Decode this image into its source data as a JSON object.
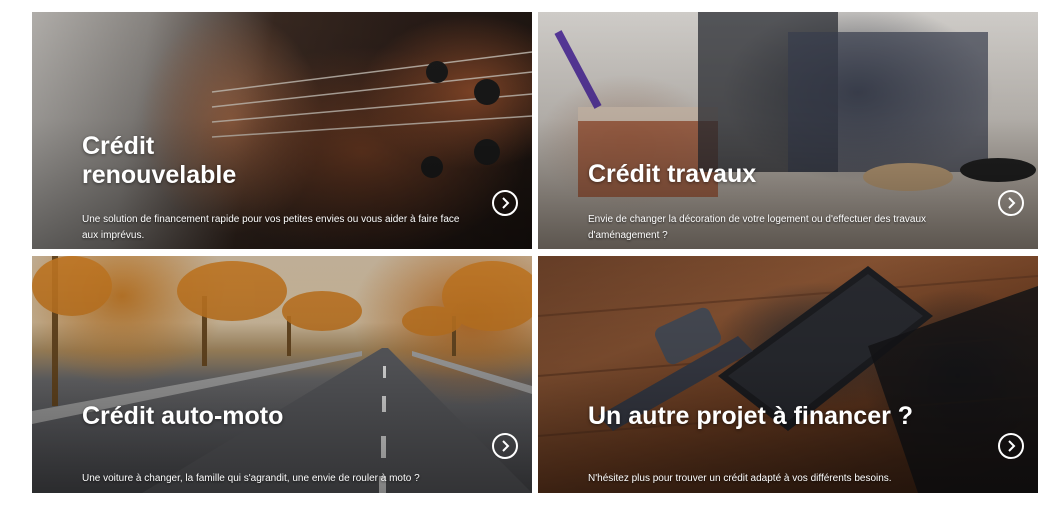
{
  "cards": [
    {
      "title": "Crédit\nrenouvelable",
      "description": "Une solution de financement rapide pour vos petites envies ou vous aider à faire face aux imprévus."
    },
    {
      "title": "Crédit travaux",
      "description": "Envie de changer la décoration de votre logement ou d'effectuer des travaux d'aménagement ?"
    },
    {
      "title": "Crédit auto-moto",
      "description": "Une voiture à changer, la famille qui s'agrandit, une envie de rouler à moto ?"
    },
    {
      "title": "Un autre projet à financer ?",
      "description": "N'hésitez plus pour trouver un crédit adapté à vos différents besoins."
    }
  ],
  "icons": {
    "arrow": "chevron-right-circle-icon"
  },
  "colors": {
    "text": "#ffffff",
    "background": "#ffffff"
  }
}
